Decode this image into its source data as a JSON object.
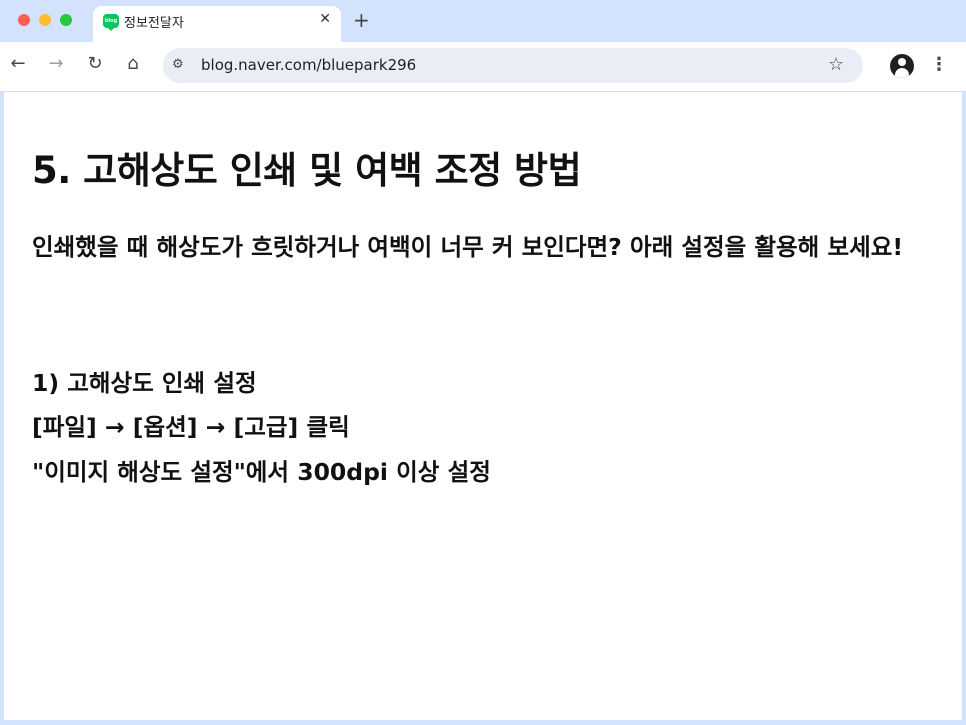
{
  "browser": {
    "tab_title": "정보전달자",
    "favicon_text": "blog",
    "close_glyph": "✕",
    "new_tab_glyph": "+",
    "url": "blog.naver.com/bluepark296",
    "icons": {
      "back": "←",
      "forward": "→",
      "reload": "↻",
      "home": "⌂",
      "site_settings": "⚙",
      "bookmark": "☆",
      "menu": "⋮"
    },
    "colors": {
      "frame": "#d3e3fd",
      "omnibox": "#e9eef6",
      "favicon": "#03c75a"
    }
  },
  "article": {
    "heading": "5. 고해상도 인쇄 및 여백 조정 방법",
    "intro": "인쇄했을 때 해상도가 흐릿하거나 여백이 너무 커 보인다면? 아래 설정을 활용해 보세요!",
    "steps": [
      "1) 고해상도 인쇄 설정",
      "[파일] → [옵션] → [고급] 클릭",
      "\"이미지 해상도 설정\"에서 300dpi 이상 설정"
    ]
  }
}
